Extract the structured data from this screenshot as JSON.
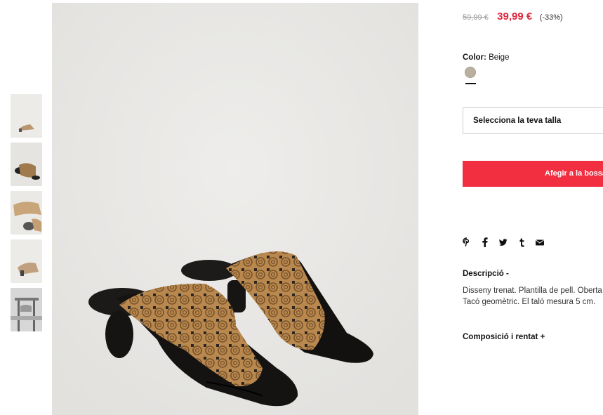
{
  "thumbnails": [
    {
      "alt": "thumb-1"
    },
    {
      "alt": "thumb-2"
    },
    {
      "alt": "thumb-3"
    },
    {
      "alt": "thumb-4"
    },
    {
      "alt": "thumb-5"
    }
  ],
  "price": {
    "old": "59,99 €",
    "new": "39,99 €",
    "discount": "(-33%)"
  },
  "color": {
    "label": "Color:",
    "value": "Beige",
    "swatch_color": "#b9b09d"
  },
  "size": {
    "placeholder": "Selecciona la teva talla"
  },
  "cart": {
    "add_label": "Afegir a la bossa"
  },
  "share": {
    "icons": [
      "pinterest-icon",
      "facebook-icon",
      "twitter-icon",
      "tumblr-icon",
      "mail-icon"
    ]
  },
  "description": {
    "title": "Descripció",
    "toggle": "-",
    "line1": "Disseny trenat. Plantilla de pell. Oberta",
    "line2": "Tacó geomètric. El taló mesura 5 cm."
  },
  "composition": {
    "title": "Composició i rentat",
    "toggle": "+"
  },
  "colors": {
    "accent": "#f22e41",
    "sale": "#e0263b"
  }
}
